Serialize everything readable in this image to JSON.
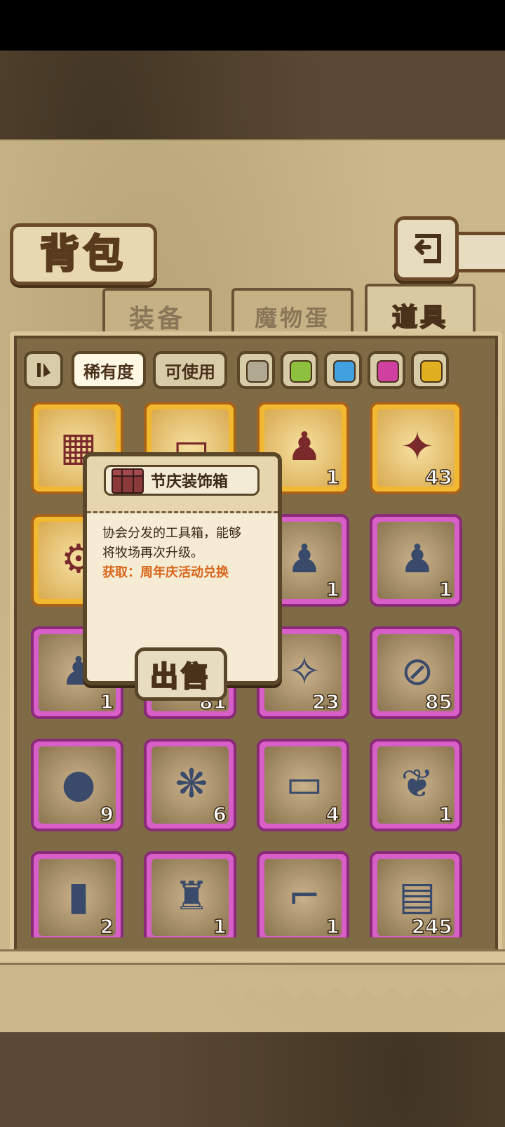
{
  "header": {
    "title": "背包"
  },
  "tabs": [
    {
      "label": "装备",
      "active": false
    },
    {
      "label": "魔物蛋",
      "active": false
    },
    {
      "label": "道具",
      "active": true
    }
  ],
  "filters": {
    "sort_icon": "sort-toggle-icon",
    "rarity_label": "稀有度",
    "usable_label": "可使用",
    "colors": [
      "#b0a890",
      "#8ec040",
      "#40a0e0",
      "#d040a0",
      "#e0b020"
    ]
  },
  "items": [
    {
      "icon": "crate-icon",
      "count": "",
      "rarity": "gold"
    },
    {
      "icon": "ticket-icon",
      "count": "",
      "rarity": "gold"
    },
    {
      "icon": "figure-icon",
      "count": "1",
      "rarity": "gold"
    },
    {
      "icon": "lantern-icon",
      "count": "43",
      "rarity": "gold"
    },
    {
      "icon": "machine-icon",
      "count": "",
      "rarity": "gold"
    },
    {
      "icon": "figure-icon",
      "count": "",
      "rarity": "pink"
    },
    {
      "icon": "figure-icon",
      "count": "1",
      "rarity": "pink"
    },
    {
      "icon": "figure-icon",
      "count": "1",
      "rarity": "pink"
    },
    {
      "icon": "figure-icon",
      "count": "1",
      "rarity": "pink"
    },
    {
      "icon": "item-icon",
      "count": "81",
      "rarity": "pink"
    },
    {
      "icon": "badge-icon",
      "count": "23",
      "rarity": "pink"
    },
    {
      "icon": "net-icon",
      "count": "85",
      "rarity": "pink"
    },
    {
      "icon": "seed-icon",
      "count": "9",
      "rarity": "pink"
    },
    {
      "icon": "hop-icon",
      "count": "6",
      "rarity": "pink"
    },
    {
      "icon": "ticket-icon",
      "count": "4",
      "rarity": "pink"
    },
    {
      "icon": "wings-icon",
      "count": "1",
      "rarity": "pink"
    },
    {
      "icon": "bottle-icon",
      "count": "2",
      "rarity": "pink"
    },
    {
      "icon": "burger-figure-icon",
      "count": "1",
      "rarity": "pink"
    },
    {
      "icon": "lever-icon",
      "count": "1",
      "rarity": "pink"
    },
    {
      "icon": "card-icon",
      "count": "245",
      "rarity": "pink"
    }
  ],
  "popup": {
    "name": "节庆装饰箱",
    "desc_line1": "协会分发的工具箱，能够",
    "desc_line2": "将牧场再次升级。",
    "source": "获取：周年庆活动兑换",
    "sell_label": "出售"
  }
}
